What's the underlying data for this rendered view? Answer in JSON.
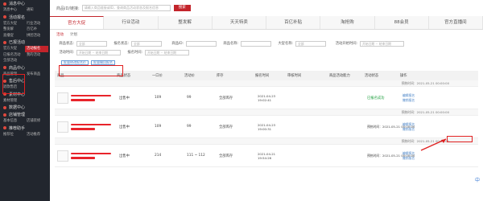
{
  "sidebar": {
    "sections": [
      {
        "title": "消息中心",
        "items": [
          "消息中心",
          "通知"
        ]
      },
      {
        "title": "活动报名",
        "items": [
          "官方大促",
          "行业活动",
          "整发解",
          "百亿补",
          "直播促",
          "拼团活动"
        ]
      },
      {
        "title": "已报活动",
        "items": [
          "官方大促",
          "已报名活动",
          "我的活动",
          "全部活动"
        ]
      },
      {
        "title": "商品中心",
        "items": [
          "商品管理",
          "",
          "发布商品"
        ]
      },
      {
        "title": "售后中心",
        "items": [
          "退款售后"
        ]
      },
      {
        "title": "素材中心",
        "items": [
          "素材管理"
        ]
      },
      {
        "title": "数据中心",
        "items": []
      },
      {
        "title": "店铺管理",
        "items": [
          "基本信息",
          "店铺装修"
        ]
      },
      {
        "title": "推荐助手",
        "items": [
          "推荐位",
          "活动推荐"
        ]
      }
    ],
    "active_item": "活动报名"
  },
  "topbar": {
    "label": "商品ID/链接:",
    "placeholder": "请输入商品链接或ID，查询商品活动状态及报名信息",
    "button": "搜索"
  },
  "tabs": [
    "官方大促",
    "行业活动",
    "整发解",
    "天天特卖",
    "百亿补贴",
    "淘抢购",
    "88会员",
    "官方直播间"
  ],
  "subtabs": [
    "活动",
    "计划"
  ],
  "filters": {
    "row1": [
      {
        "label": "商品状态:",
        "value": "全部"
      },
      {
        "label": "报名状态:",
        "value": "全部"
      },
      {
        "label": "商品ID:",
        "value": ""
      },
      {
        "label": "商品名称:",
        "value": ""
      },
      {
        "label": "大促名称:",
        "value": "全部"
      },
      {
        "label": "活动开始时间:",
        "value": "开始日期 ~ 结束日期"
      }
    ],
    "row2": [
      {
        "label": "活动时间:",
        "value": "开始日期 ~ 结束日期"
      },
      {
        "label": "报名时间:",
        "value": "开始日期 ~ 结束日期"
      }
    ]
  },
  "actions": [
    "批量修改报名价",
    "批量撤回报名"
  ],
  "table": {
    "headers": [
      "商品",
      "商品状态",
      "一口价",
      "活动价",
      "库存",
      "报名时间",
      "审核时间",
      "商品活动能力",
      "活动状态",
      "操作"
    ],
    "rows": [
      {
        "status": "出售中",
        "price": "109",
        "act_price": "99",
        "stock": "全部库存",
        "time": "2021-04-23 19:02:41",
        "head": "预热时间：2021-05-21 00:00:00",
        "act_status": "已报名成功",
        "act_time": "预热时间：2021-05-21 00:00:00",
        "op1": "编辑报名",
        "op2": "撤销报名"
      },
      {
        "status": "出售中",
        "price": "109",
        "act_price": "99",
        "stock": "全部库存",
        "time": "2021-04-23 19:00:31",
        "head": "预热时间：2021-05-21 00:00:00",
        "act_status": "",
        "act_time": "预热时间：2021-05-21 00:00:00",
        "op1": "编辑报名",
        "op2": "撤销报名"
      },
      {
        "status": "出售中",
        "price": "214",
        "act_price": "111 ~ 112",
        "stock": "全部库存",
        "time": "2021-04-21 19:54:26",
        "head": "预热时间：2021-05-21 00:00:00",
        "act_status": "",
        "act_time": "预热时间：2021-05-21 00:00:00",
        "op1": "编辑报名",
        "op2": "撤销报名"
      }
    ]
  },
  "float_char": "中",
  "colors": {
    "brand": "#c3242b",
    "sidebar_bg": "#22262e",
    "link": "#4a84c7",
    "ok": "#21a040"
  }
}
